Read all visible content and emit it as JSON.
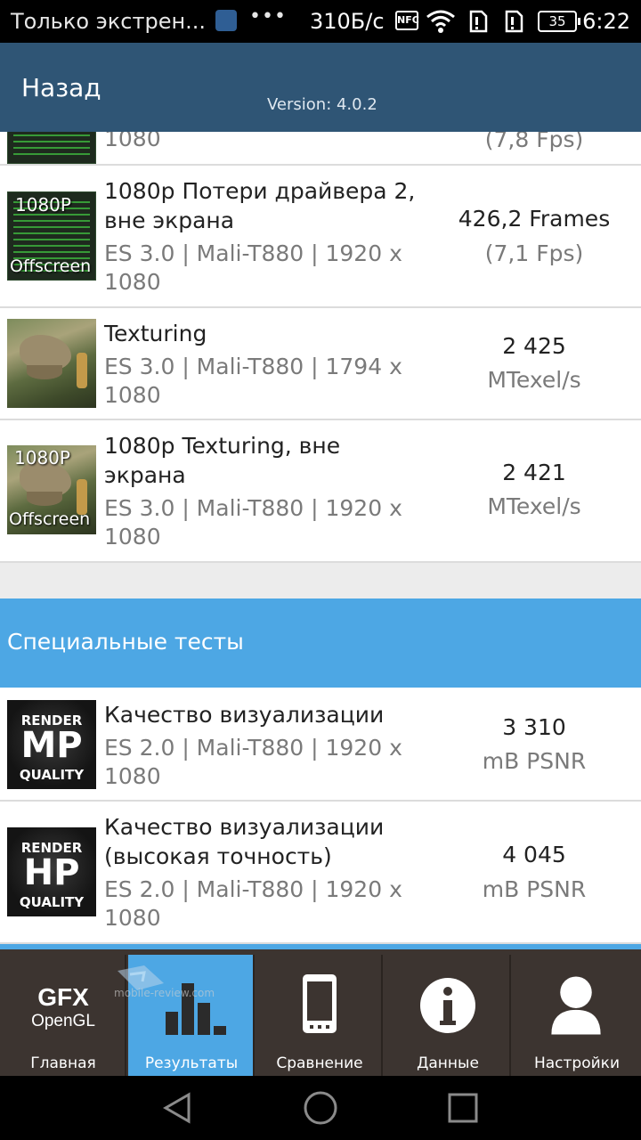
{
  "status_bar": {
    "notification": "Только экстрен...",
    "speed": "310Б/с",
    "nfc": "NFC",
    "battery": "35",
    "time": "6:22"
  },
  "header": {
    "back_label": "Назад",
    "version": "Version: 4.0.2"
  },
  "results": [
    {
      "thumb": "graph",
      "title": "",
      "subtitle": "1080",
      "value": "",
      "unit": "(7,8 Fps)"
    },
    {
      "thumb": "graph-offscreen",
      "title": "1080p Потери драйвера 2, вне экрана",
      "subtitle": "ES 3.0 | Mali-T880 | 1920 x 1080",
      "value": "426,2 Frames",
      "unit": "(7,1 Fps)"
    },
    {
      "thumb": "dino",
      "title": "Texturing",
      "subtitle": "ES 3.0 | Mali-T880 | 1794 x 1080",
      "value": "2 425",
      "unit": "MTexel/s"
    },
    {
      "thumb": "dino-offscreen",
      "title": "1080p Texturing, вне экрана",
      "subtitle": "ES 3.0 | Mali-T880 | 1920 x 1080",
      "value": "2 421",
      "unit": "MTexel/s"
    }
  ],
  "thumb_tags": {
    "p1080": "1080P",
    "offscreen": "Offscreen"
  },
  "section_title": "Специальные тесты",
  "special": [
    {
      "thumb_top": "RENDER",
      "thumb_mid": "MP",
      "thumb_bot": "QUALITY",
      "title": "Качество визуализации",
      "subtitle": "ES 2.0 | Mali-T880 | 1920 x 1080",
      "value": "3 310",
      "unit": "mB PSNR"
    },
    {
      "thumb_top": "RENDER",
      "thumb_mid": "HP",
      "thumb_bot": "QUALITY",
      "title": "Качество визуализации (высокая точность)",
      "subtitle": "ES 2.0 | Mali-T880 | 1920 x 1080",
      "value": "4 045",
      "unit": "mB PSNR"
    }
  ],
  "tabs": {
    "home": {
      "label": "Главная",
      "logo_top": "GFX",
      "logo_bottom": "OpenGL"
    },
    "results": {
      "label": "Результаты"
    },
    "compare": {
      "label": "Сравнение"
    },
    "info": {
      "label": "Данные"
    },
    "settings": {
      "label": "Настройки"
    }
  },
  "watermark": "mobile-review.com",
  "colors": {
    "header": "#2f5575",
    "accent": "#4da7e4",
    "tabbar": "#3c3430"
  }
}
